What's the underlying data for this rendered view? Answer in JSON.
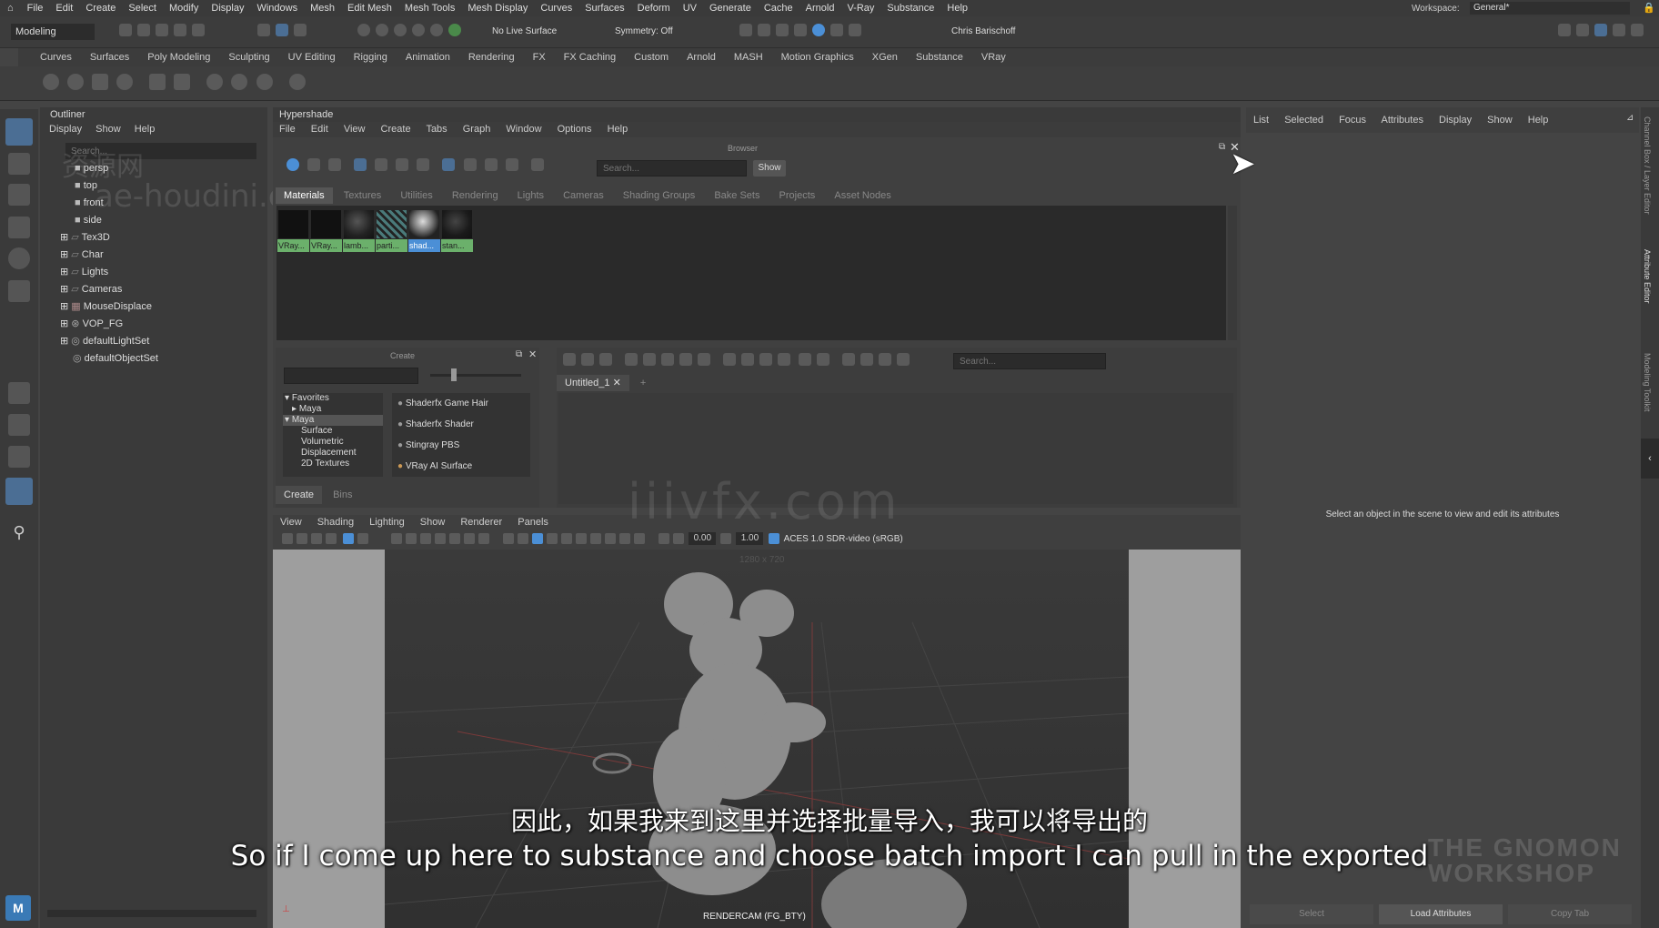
{
  "menubar": {
    "items": [
      "File",
      "Edit",
      "Create",
      "Select",
      "Modify",
      "Display",
      "Windows",
      "Mesh",
      "Edit Mesh",
      "Mesh Tools",
      "Mesh Display",
      "Curves",
      "Surfaces",
      "Deform",
      "UV",
      "Generate",
      "Cache",
      "Arnold",
      "V-Ray",
      "Substance",
      "Help"
    ],
    "workspace_label": "Workspace:",
    "workspace_value": "General*"
  },
  "toolbar": {
    "mode": "Modeling",
    "live_surface": "No Live Surface",
    "symmetry": "Symmetry: Off",
    "user": "Chris Barischoff"
  },
  "shelf": {
    "tabs": [
      "Curves",
      "Surfaces",
      "Poly Modeling",
      "Sculpting",
      "UV Editing",
      "Rigging",
      "Animation",
      "Rendering",
      "FX",
      "FX Caching",
      "Custom",
      "Arnold",
      "MASH",
      "Motion Graphics",
      "XGen",
      "Substance",
      "VRay"
    ]
  },
  "outliner": {
    "title": "Outliner",
    "menu": [
      "Display",
      "Show",
      "Help"
    ],
    "search_placeholder": "Search...",
    "items": [
      {
        "label": "persp"
      },
      {
        "label": "top"
      },
      {
        "label": "front"
      },
      {
        "label": "side"
      },
      {
        "label": "Tex3D"
      },
      {
        "label": "Char"
      },
      {
        "label": "Lights"
      },
      {
        "label": "Cameras"
      },
      {
        "label": "MouseDisplace"
      },
      {
        "label": "VOP_FG"
      },
      {
        "label": "defaultLightSet"
      },
      {
        "label": "defaultObjectSet"
      }
    ]
  },
  "hypershade": {
    "title": "Hypershade",
    "menu": [
      "File",
      "Edit",
      "View",
      "Create",
      "Tabs",
      "Graph",
      "Window",
      "Options",
      "Help"
    ],
    "browser_label": "Browser",
    "search_placeholder": "Search...",
    "show_label": "Show",
    "tabs": [
      "Materials",
      "Textures",
      "Utilities",
      "Rendering",
      "Lights",
      "Cameras",
      "Shading Groups",
      "Bake Sets",
      "Projects",
      "Asset Nodes"
    ],
    "swatches": [
      "VRay...",
      "VRay...",
      "lamb...",
      "parti...",
      "shad...",
      "stan..."
    ],
    "create_label": "Create",
    "create_tree": [
      "Favorites",
      "Maya",
      "Maya",
      "Surface",
      "Volumetric",
      "Displacement",
      "2D Textures"
    ],
    "create_list": [
      "Shaderfx Game Hair",
      "Shaderfx Shader",
      "Stingray PBS",
      "VRay AI Surface"
    ],
    "bottom_tabs": [
      "Create",
      "Bins"
    ],
    "graph_search_placeholder": "Search...",
    "graph_tab": "Untitled_1",
    "graph_tab_add": "+"
  },
  "viewport": {
    "menu": [
      "View",
      "Shading",
      "Lighting",
      "Show",
      "Renderer",
      "Panels"
    ],
    "value_a": "0.00",
    "value_b": "1.00",
    "colorspace": "ACES 1.0 SDR-video (sRGB)",
    "resolution": "1280 x 720",
    "camera": "RENDERCAM (FG_BTY)"
  },
  "attr": {
    "menu": [
      "List",
      "Selected",
      "Focus",
      "Attributes",
      "Display",
      "Show",
      "Help"
    ],
    "message": "Select an object in the scene to view and edit its attributes",
    "buttons": [
      "Select",
      "Load Attributes",
      "Copy Tab"
    ],
    "side_tabs": [
      "Channel Box / Layer Editor",
      "Attribute Editor",
      "Modeling Toolkit"
    ]
  },
  "subtitles": {
    "cn": "因此，如果我来到这里并选择批量导入，我可以将导出的",
    "en": "So if I come up here to substance and choose batch import I can pull in the exported"
  },
  "watermarks": {
    "a": "资源网",
    "b": "ae-houdini.com",
    "c": "iiivfx.com",
    "d": "THE GNOMON WORKSHOP"
  },
  "colors": {
    "accent": "#4b8fd6",
    "swatch_label": "#6bb06b",
    "bg": "#444444"
  }
}
